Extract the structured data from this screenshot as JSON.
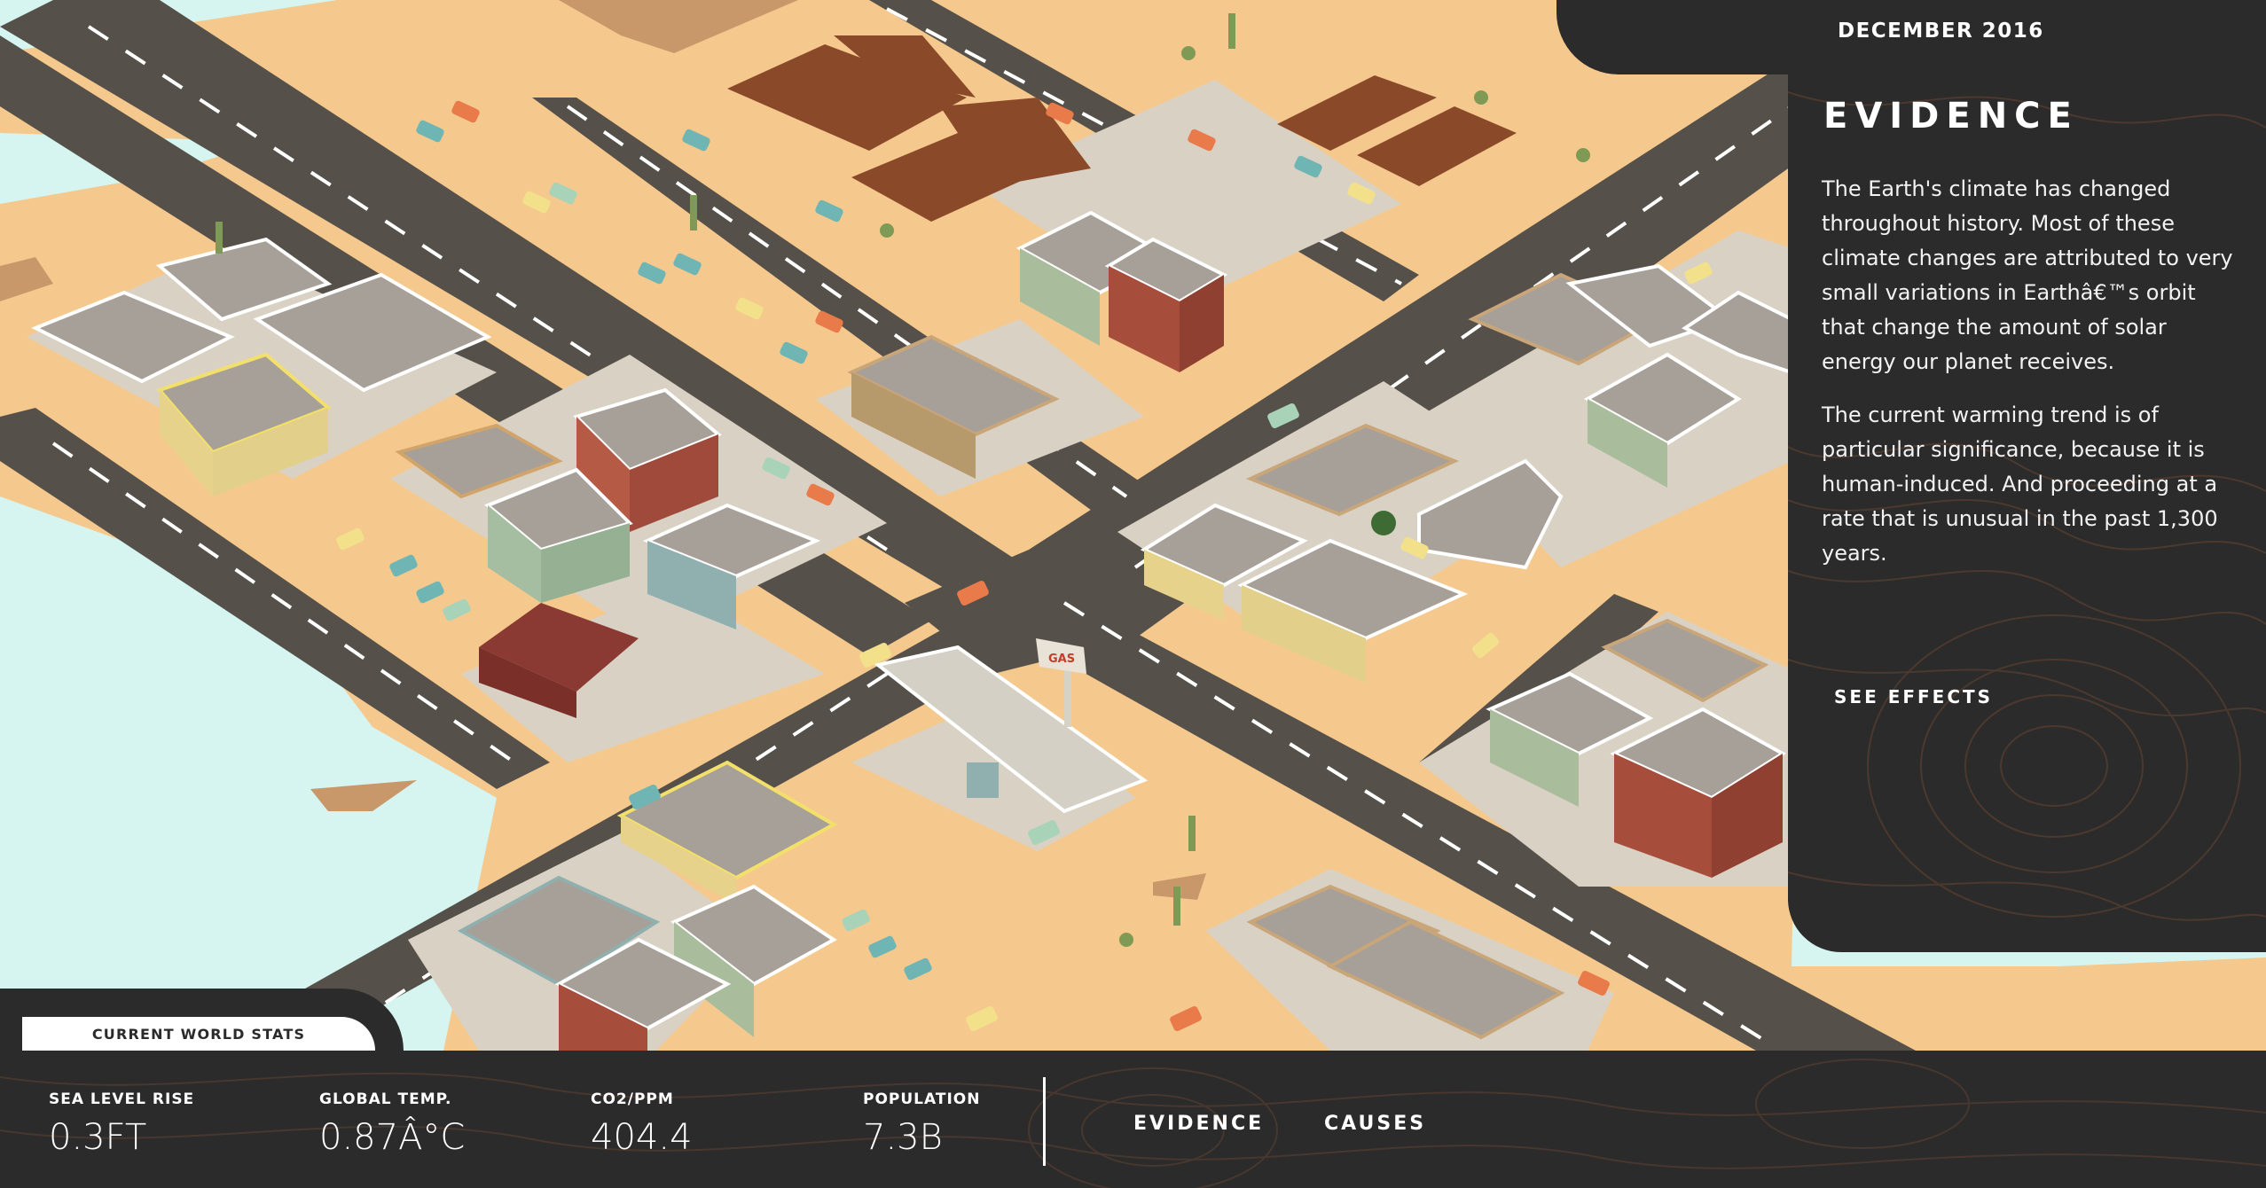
{
  "colors": {
    "water": "#d6f5f1",
    "sand": "#f5c98e",
    "road": "#555049",
    "panel": "#2b2b2b",
    "topo_lines": "#7a5038"
  },
  "header": {
    "date": "DECEMBER 2016"
  },
  "panel": {
    "title": "EVIDENCE",
    "paragraph1": "The Earth's climate has changed throughout history. Most of these climate changes are attributed to very small variations in Earthâ€™s orbit that change the amount of solar energy our planet receives.",
    "paragraph2": "The current warming trend is of particular significance, because it is human-induced. And proceeding at a rate that is unusual in the past 1,300 years.",
    "cta": "SEE EFFECTS"
  },
  "stats_tab": {
    "label": "CURRENT WORLD STATS"
  },
  "stats": [
    {
      "label": "SEA LEVEL RISE",
      "value": "0.3FT"
    },
    {
      "label": "GLOBAL TEMP.",
      "value": "0.87Â°C"
    },
    {
      "label": "CO2/PPM",
      "value": "404.4"
    },
    {
      "label": "POPULATION",
      "value": "7.3B"
    }
  ],
  "nav": {
    "evidence": "EVIDENCE",
    "causes": "CAUSES"
  },
  "scene": {
    "gas_sign": "GAS"
  }
}
